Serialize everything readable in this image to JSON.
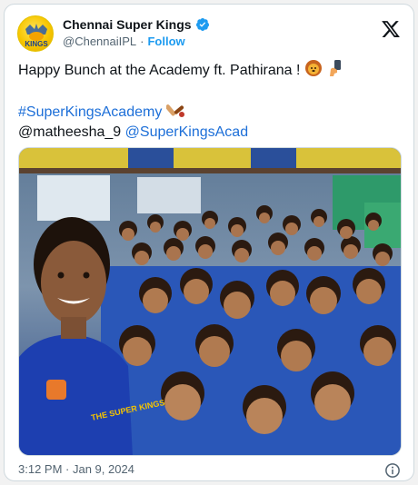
{
  "author": {
    "display_name": "Chennai Super Kings",
    "handle": "@ChennaiIPL",
    "separator": "·",
    "follow_label": "Follow",
    "verified": true,
    "avatar_text": "KINGS"
  },
  "tweet": {
    "line1": "Happy Bunch at the Academy ft. Pathirana !",
    "hashtag": "#SuperKingsAcademy",
    "mention1": "@matheesha_9",
    "mention2": "@SuperKingsAcad"
  },
  "media": {
    "jersey_text": "THE SUPER KINGS",
    "description_icon": "group-selfie-photo"
  },
  "footer": {
    "timestamp": "3:12 PM · Jan 9, 2024"
  },
  "colors": {
    "accent": "#1d9bf0",
    "link": "#1d6fd8",
    "verified": "#1d9bf0",
    "muted": "#536471"
  }
}
